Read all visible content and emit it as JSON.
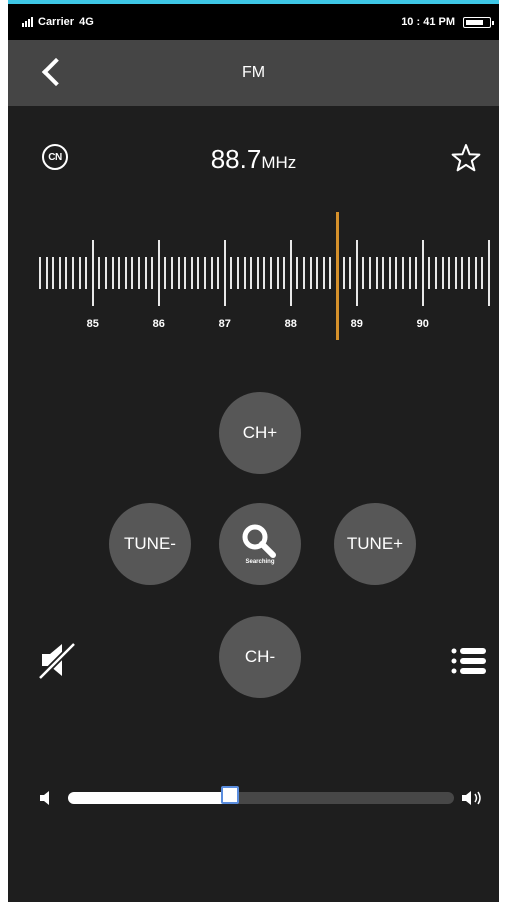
{
  "status_bar": {
    "carrier": "Carrier",
    "network": "4G",
    "time": "10 : 41 PM"
  },
  "nav": {
    "title": "FM",
    "back_icon": "chevron-left-icon"
  },
  "radio": {
    "region_badge": "CN",
    "frequency_value": "88.7",
    "frequency_unit": "MHz",
    "favorite_icon": "star-outline-icon",
    "tuned_frequency": 88.7,
    "scale_labels": [
      "85",
      "86",
      "87",
      "88",
      "89",
      "90"
    ],
    "needle_color": "#d6912b"
  },
  "controls": {
    "ch_plus": "CH+",
    "ch_minus": "CH-",
    "tune_minus": "TUNE-",
    "tune_plus": "TUNE+",
    "search_label": "Searching",
    "search_icon": "search-icon",
    "mute_icon": "speaker-muted-icon",
    "list_icon": "list-icon"
  },
  "volume": {
    "level": 0.42,
    "low_icon": "volume-low-icon",
    "high_icon": "volume-high-icon"
  },
  "colors": {
    "background": "#1e1e1e",
    "navbar": "#454545",
    "button": "#575757",
    "accent": "#d6912b",
    "slider_thumb_border": "#5a8dde"
  }
}
